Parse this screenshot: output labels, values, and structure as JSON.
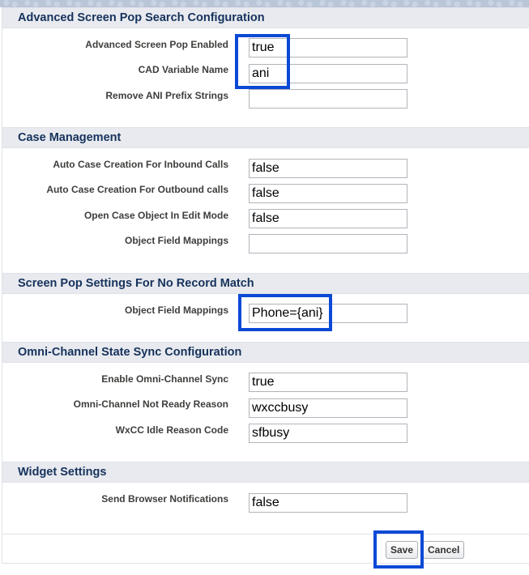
{
  "sections": [
    {
      "title": "Advanced Screen Pop Search Configuration",
      "fields": [
        {
          "label": "Advanced Screen Pop Enabled",
          "value": "true"
        },
        {
          "label": "CAD Variable Name",
          "value": "ani"
        },
        {
          "label": "Remove ANI Prefix Strings",
          "value": ""
        }
      ]
    },
    {
      "title": "Case Management",
      "fields": [
        {
          "label": "Auto Case Creation For Inbound Calls",
          "value": "false"
        },
        {
          "label": "Auto Case Creation For Outbound calls",
          "value": "false"
        },
        {
          "label": "Open Case Object In Edit Mode",
          "value": "false"
        },
        {
          "label": "Object Field Mappings",
          "value": ""
        }
      ]
    },
    {
      "title": "Screen Pop Settings For No Record Match",
      "fields": [
        {
          "label": "Object Field Mappings",
          "value": "Phone={ani}"
        }
      ]
    },
    {
      "title": "Omni-Channel State Sync Configuration",
      "fields": [
        {
          "label": "Enable Omni-Channel Sync",
          "value": "true"
        },
        {
          "label": "Omni-Channel Not Ready Reason",
          "value": "wxccbusy"
        },
        {
          "label": "WxCC Idle Reason Code",
          "value": "sfbusy"
        }
      ]
    },
    {
      "title": "Widget Settings",
      "fields": [
        {
          "label": "Send Browser Notifications",
          "value": "false"
        }
      ]
    }
  ],
  "buttons": {
    "save": "Save",
    "cancel": "Cancel"
  },
  "colors": {
    "highlight": "#0a49d6",
    "header_text": "#16325c",
    "header_bg": "#e8eaef"
  }
}
